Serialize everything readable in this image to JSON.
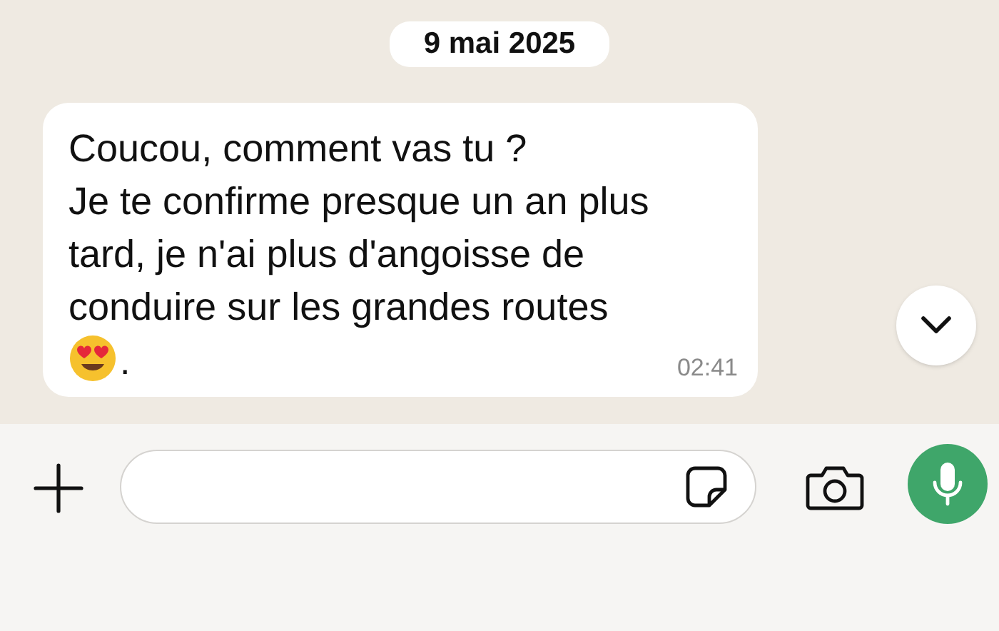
{
  "date_chip": "9 mai 2025",
  "message": {
    "text": "Coucou, comment vas tu ?\nJe te confirme presque un an plus tard, je n'ai plus d'angoisse de conduire sur les grandes routes",
    "trailing": ".",
    "time": "02:41"
  }
}
